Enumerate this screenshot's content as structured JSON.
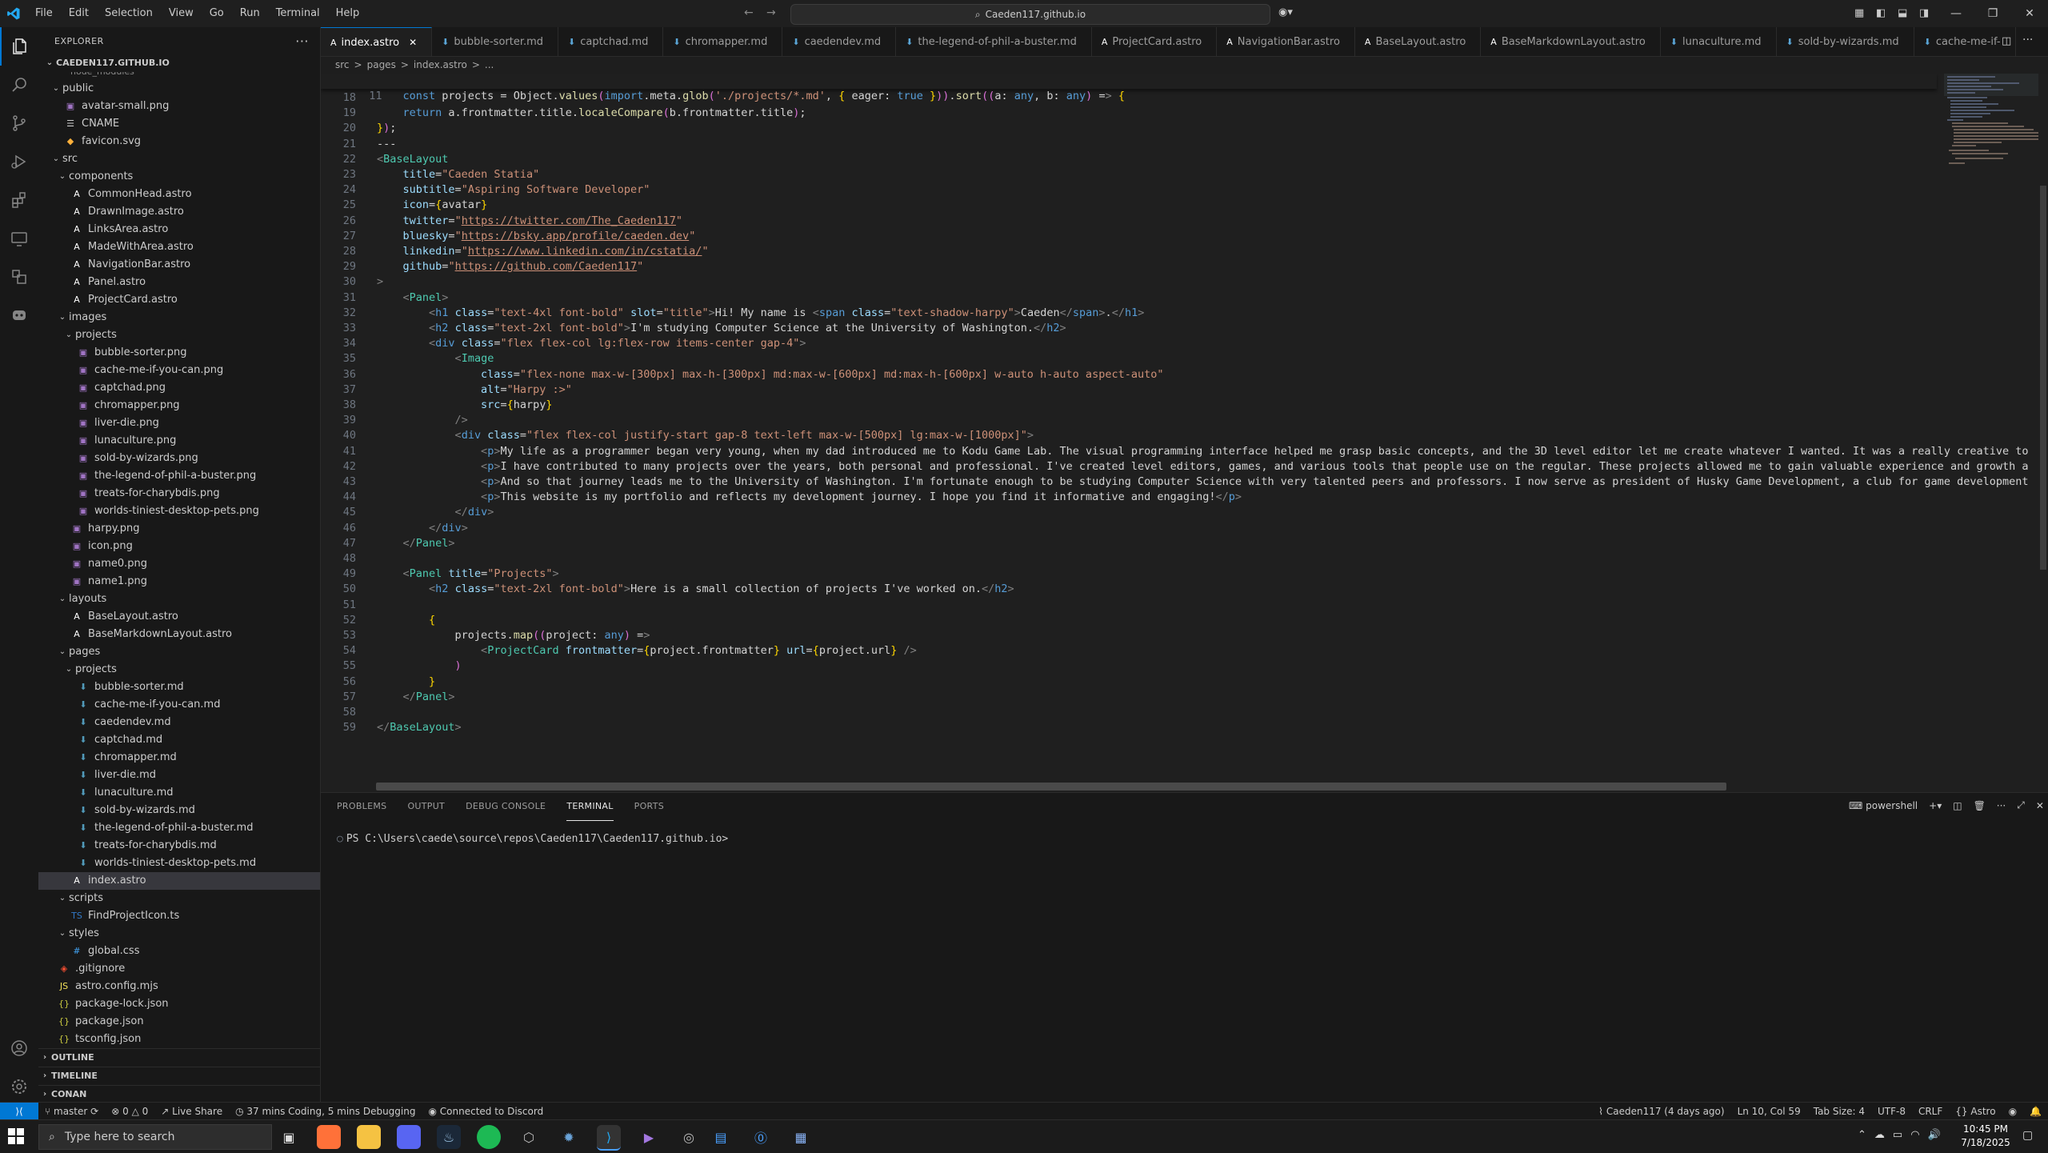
{
  "menu": [
    "File",
    "Edit",
    "Selection",
    "View",
    "Go",
    "Run",
    "Terminal",
    "Help"
  ],
  "command_center": "Caeden117.github.io",
  "window_controls": [
    "minimize-icon",
    "restore-icon",
    "close-icon"
  ],
  "sidebar": {
    "title": "EXPLORER",
    "root": "CAEDEN117.GITHUB.IO",
    "partial_top": "node_modules",
    "tree": [
      {
        "label": "public",
        "depth": 0,
        "type": "folder-open"
      },
      {
        "label": "avatar-small.png",
        "depth": 1,
        "type": "image"
      },
      {
        "label": "CNAME",
        "depth": 1,
        "type": "file"
      },
      {
        "label": "favicon.svg",
        "depth": 1,
        "type": "svg"
      },
      {
        "label": "src",
        "depth": 0,
        "type": "folder-open"
      },
      {
        "label": "components",
        "depth": 1,
        "type": "folder-open"
      },
      {
        "label": "CommonHead.astro",
        "depth": 2,
        "type": "astro"
      },
      {
        "label": "DrawnImage.astro",
        "depth": 2,
        "type": "astro"
      },
      {
        "label": "LinksArea.astro",
        "depth": 2,
        "type": "astro"
      },
      {
        "label": "MadeWithArea.astro",
        "depth": 2,
        "type": "astro"
      },
      {
        "label": "NavigationBar.astro",
        "depth": 2,
        "type": "astro"
      },
      {
        "label": "Panel.astro",
        "depth": 2,
        "type": "astro"
      },
      {
        "label": "ProjectCard.astro",
        "depth": 2,
        "type": "astro"
      },
      {
        "label": "images",
        "depth": 1,
        "type": "folder-open"
      },
      {
        "label": "projects",
        "depth": 2,
        "type": "folder-open"
      },
      {
        "label": "bubble-sorter.png",
        "depth": 3,
        "type": "image"
      },
      {
        "label": "cache-me-if-you-can.png",
        "depth": 3,
        "type": "image"
      },
      {
        "label": "captchad.png",
        "depth": 3,
        "type": "image"
      },
      {
        "label": "chromapper.png",
        "depth": 3,
        "type": "image"
      },
      {
        "label": "liver-die.png",
        "depth": 3,
        "type": "image"
      },
      {
        "label": "lunaculture.png",
        "depth": 3,
        "type": "image"
      },
      {
        "label": "sold-by-wizards.png",
        "depth": 3,
        "type": "image"
      },
      {
        "label": "the-legend-of-phil-a-buster.png",
        "depth": 3,
        "type": "image"
      },
      {
        "label": "treats-for-charybdis.png",
        "depth": 3,
        "type": "image"
      },
      {
        "label": "worlds-tiniest-desktop-pets.png",
        "depth": 3,
        "type": "image"
      },
      {
        "label": "harpy.png",
        "depth": 2,
        "type": "image"
      },
      {
        "label": "icon.png",
        "depth": 2,
        "type": "image"
      },
      {
        "label": "name0.png",
        "depth": 2,
        "type": "image"
      },
      {
        "label": "name1.png",
        "depth": 2,
        "type": "image"
      },
      {
        "label": "layouts",
        "depth": 1,
        "type": "folder-open"
      },
      {
        "label": "BaseLayout.astro",
        "depth": 2,
        "type": "astro"
      },
      {
        "label": "BaseMarkdownLayout.astro",
        "depth": 2,
        "type": "astro"
      },
      {
        "label": "pages",
        "depth": 1,
        "type": "folder-open"
      },
      {
        "label": "projects",
        "depth": 2,
        "type": "folder-open"
      },
      {
        "label": "bubble-sorter.md",
        "depth": 3,
        "type": "md"
      },
      {
        "label": "cache-me-if-you-can.md",
        "depth": 3,
        "type": "md"
      },
      {
        "label": "caedendev.md",
        "depth": 3,
        "type": "md"
      },
      {
        "label": "captchad.md",
        "depth": 3,
        "type": "md"
      },
      {
        "label": "chromapper.md",
        "depth": 3,
        "type": "md"
      },
      {
        "label": "liver-die.md",
        "depth": 3,
        "type": "md"
      },
      {
        "label": "lunaculture.md",
        "depth": 3,
        "type": "md"
      },
      {
        "label": "sold-by-wizards.md",
        "depth": 3,
        "type": "md"
      },
      {
        "label": "the-legend-of-phil-a-buster.md",
        "depth": 3,
        "type": "md"
      },
      {
        "label": "treats-for-charybdis.md",
        "depth": 3,
        "type": "md"
      },
      {
        "label": "worlds-tiniest-desktop-pets.md",
        "depth": 3,
        "type": "md"
      },
      {
        "label": "index.astro",
        "depth": 2,
        "type": "astro",
        "selected": true
      },
      {
        "label": "scripts",
        "depth": 1,
        "type": "folder-open"
      },
      {
        "label": "FindProjectIcon.ts",
        "depth": 2,
        "type": "ts"
      },
      {
        "label": "styles",
        "depth": 1,
        "type": "folder-open"
      },
      {
        "label": "global.css",
        "depth": 2,
        "type": "css"
      },
      {
        "label": ".gitignore",
        "depth": 0,
        "type": "git"
      },
      {
        "label": "astro.config.mjs",
        "depth": 0,
        "type": "js"
      },
      {
        "label": "package-lock.json",
        "depth": 0,
        "type": "json"
      },
      {
        "label": "package.json",
        "depth": 0,
        "type": "json"
      },
      {
        "label": "tsconfig.json",
        "depth": 0,
        "type": "json"
      }
    ],
    "sections": [
      "OUTLINE",
      "TIMELINE",
      "CONAN"
    ]
  },
  "tabs": [
    {
      "label": "index.astro",
      "icon": "astro",
      "active": true
    },
    {
      "label": "bubble-sorter.md",
      "icon": "md"
    },
    {
      "label": "captchad.md",
      "icon": "md"
    },
    {
      "label": "chromapper.md",
      "icon": "md"
    },
    {
      "label": "caedendev.md",
      "icon": "md"
    },
    {
      "label": "the-legend-of-phil-a-buster.md",
      "icon": "md"
    },
    {
      "label": "ProjectCard.astro",
      "icon": "astro"
    },
    {
      "label": "NavigationBar.astro",
      "icon": "astro"
    },
    {
      "label": "BaseLayout.astro",
      "icon": "astro"
    },
    {
      "label": "BaseMarkdownLayout.astro",
      "icon": "astro"
    },
    {
      "label": "lunaculture.md",
      "icon": "md"
    },
    {
      "label": "sold-by-wizards.md",
      "icon": "md"
    },
    {
      "label": "cache-me-if-",
      "icon": "md"
    }
  ],
  "breadcrumb": [
    "src",
    ">",
    "pages",
    ">",
    "index.astro",
    ">",
    "..."
  ],
  "editor": {
    "sticky": {
      "num": "11",
      "text": "const projects = Object.values(import.meta.glob('./projects/*.md', { eager: true })).sort((a: any, b: any) => {"
    },
    "lines": [
      {
        "num": "18",
        "text": ""
      },
      {
        "num": "19",
        "text": "    return a.frontmatter.title.localeCompare(b.frontmatter.title);"
      },
      {
        "num": "20",
        "text": "});"
      },
      {
        "num": "21",
        "text": "---"
      },
      {
        "num": "22",
        "text": "<BaseLayout"
      },
      {
        "num": "23",
        "text": "    title=\"Caeden Statia\""
      },
      {
        "num": "24",
        "text": "    subtitle=\"Aspiring Software Developer\""
      },
      {
        "num": "25",
        "text": "    icon={avatar}"
      },
      {
        "num": "26",
        "text": "    twitter=\"https://twitter.com/The_Caeden117\""
      },
      {
        "num": "27",
        "text": "    bluesky=\"https://bsky.app/profile/caeden.dev\""
      },
      {
        "num": "28",
        "text": "    linkedin=\"https://www.linkedin.com/in/cstatia/\""
      },
      {
        "num": "29",
        "text": "    github=\"https://github.com/Caeden117\""
      },
      {
        "num": "30",
        "text": ">"
      },
      {
        "num": "31",
        "text": "    <Panel>"
      },
      {
        "num": "32",
        "text": "        <h1 class=\"text-4xl font-bold\" slot=\"title\">Hi! My name is <span class=\"text-shadow-harpy\">Caeden</span>.</h1>"
      },
      {
        "num": "33",
        "text": "        <h2 class=\"text-2xl font-bold\">I'm studying Computer Science at the University of Washington.</h2>"
      },
      {
        "num": "34",
        "text": "        <div class=\"flex flex-col lg:flex-row items-center gap-4\">"
      },
      {
        "num": "35",
        "text": "            <Image"
      },
      {
        "num": "36",
        "text": "                class=\"flex-none max-w-[300px] max-h-[300px] md:max-w-[600px] md:max-h-[600px] w-auto h-auto aspect-auto\""
      },
      {
        "num": "37",
        "text": "                alt=\"Harpy :>\""
      },
      {
        "num": "38",
        "text": "                src={harpy}"
      },
      {
        "num": "39",
        "text": "            />"
      },
      {
        "num": "40",
        "text": "            <div class=\"flex flex-col justify-start gap-8 text-left max-w-[500px] lg:max-w-[1000px]\">"
      },
      {
        "num": "41",
        "text": "                <p>My life as a programmer began very young, when my dad introduced me to Kodu Game Lab. The visual programming interface helped me grasp basic concepts, and the 3D level editor let me create whatever I wanted. It was a really creative to"
      },
      {
        "num": "42",
        "text": "                <p>I have contributed to many projects over the years, both personal and professional. I've created level editors, games, and various tools that people use on the regular. These projects allowed me to gain valuable experience and growth a"
      },
      {
        "num": "43",
        "text": "                <p>And so that journey leads me to the University of Washington. I'm fortunate enough to be studying Computer Science with very talented peers and professors. I now serve as president of Husky Game Development, a club for game development"
      },
      {
        "num": "44",
        "text": "                <p>This website is my portfolio and reflects my development journey. I hope you find it informative and engaging!</p>"
      },
      {
        "num": "45",
        "text": "            </div>"
      },
      {
        "num": "46",
        "text": "        </div>"
      },
      {
        "num": "47",
        "text": "    </Panel>"
      },
      {
        "num": "48",
        "text": ""
      },
      {
        "num": "49",
        "text": "    <Panel title=\"Projects\">"
      },
      {
        "num": "50",
        "text": "        <h2 class=\"text-2xl font-bold\">Here is a small collection of projects I've worked on.</h2>"
      },
      {
        "num": "51",
        "text": ""
      },
      {
        "num": "52",
        "text": "        {"
      },
      {
        "num": "53",
        "text": "            projects.map((project: any) =>"
      },
      {
        "num": "54",
        "text": "                <ProjectCard frontmatter={project.frontmatter} url={project.url} />"
      },
      {
        "num": "55",
        "text": "            )"
      },
      {
        "num": "56",
        "text": "        }"
      },
      {
        "num": "57",
        "text": "    </Panel>"
      },
      {
        "num": "58",
        "text": ""
      },
      {
        "num": "59",
        "text": "</BaseLayout>"
      }
    ]
  },
  "panel": {
    "tabs": [
      "PROBLEMS",
      "OUTPUT",
      "DEBUG CONSOLE",
      "TERMINAL",
      "PORTS"
    ],
    "active_tab": "TERMINAL",
    "shell": "powershell",
    "prompt": "PS C:\\Users\\caede\\source\\repos\\Caeden117\\Caeden117.github.io>"
  },
  "statusbar": {
    "branch": "master",
    "problems": "0 △ 0",
    "errors": "0",
    "warnings": "0",
    "live_share": "Live Share",
    "coding_time": "37 mins Coding, 5 mins Debugging",
    "discord": "Connected to Discord",
    "blame": "Caeden117 (4 days ago)",
    "position": "Ln 10, Col 59",
    "tab_size": "Tab Size: 4",
    "encoding": "UTF-8",
    "eol": "CRLF",
    "language": "Astro"
  },
  "taskbar": {
    "search_placeholder": "Type here to search",
    "time": "10:45 PM",
    "date": "7/18/2025"
  },
  "colors": {
    "accent": "#0078d4",
    "editor_bg": "#1f1f1f",
    "sidebar_bg": "#181818"
  }
}
